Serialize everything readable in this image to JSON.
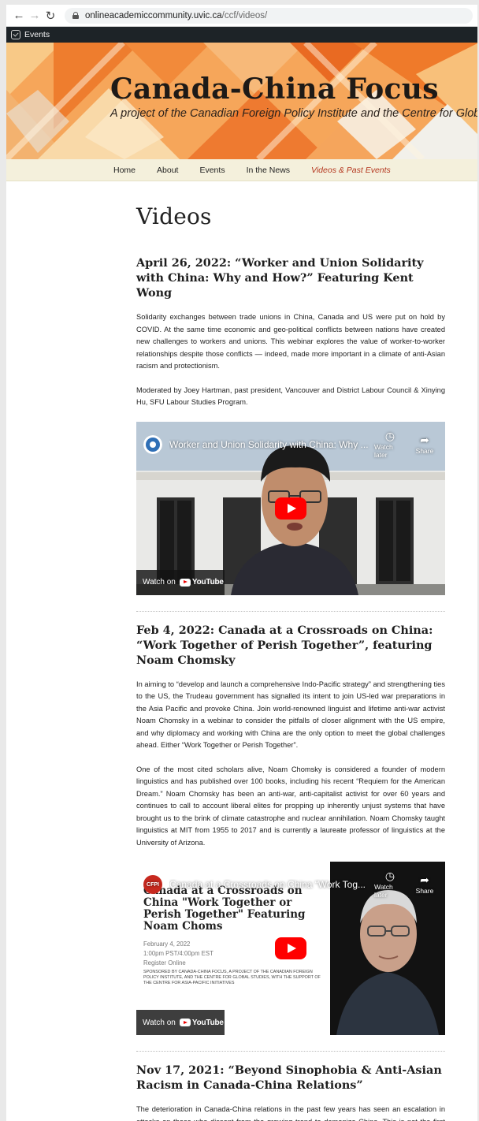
{
  "browser": {
    "url_domain": "onlineacademiccommunity.uvic.ca",
    "url_path": "/ccf/videos/"
  },
  "admin_bar": {
    "label": "Events"
  },
  "site": {
    "title": "Canada-China Focus",
    "description": "A project of the Canadian Foreign Policy Institute and the Centre for Global Studies"
  },
  "nav": {
    "items": [
      "Home",
      "About",
      "Events",
      "In the News",
      "Videos & Past Events"
    ],
    "current_index": 4
  },
  "page": {
    "title": "Videos"
  },
  "entries": [
    {
      "title": "April 26, 2022: “Worker and Union Solidarity with China: Why and How?” Featuring Kent Wong",
      "paragraphs": [
        "Solidarity exchanges between trade unions in China, Canada and US were put on hold by COVID. At the same time economic and geo-political conflicts between nations have created new challenges to workers and unions. This webinar explores the value of worker-to-worker relationships despite those conflicts — indeed, made more important in a climate of anti-Asian racism and protectionism.",
        "Moderated by Joey Hartman, past president, Vancouver and District Labour Council & Xinying Hu, SFU Labour Studies Program."
      ],
      "video": {
        "title": "Worker and Union Solidarity with China: Why ...",
        "watch_later": "Watch later",
        "share": "Share",
        "watch_on": "Watch on",
        "youtube": "YouTube"
      }
    },
    {
      "title": "Feb 4, 2022: Canada at a Crossroads on China: “Work Together of Perish Together”, featuring Noam Chomsky",
      "paragraphs": [
        "In aiming to “develop and launch a comprehensive Indo-Pacific strategy” and strengthening ties to the US, the Trudeau government has signalled its intent to join US-led war preparations in the Asia Pacific and provoke China. Join world-renowned linguist and lifetime anti-war activist Noam Chomsky in a webinar to consider the pitfalls of closer alignment with the US empire, and why diplomacy and working with China are the only option to meet the global challenges ahead. Either “Work Together or Perish Together”.",
        "One of the most cited scholars alive, Noam Chomsky is considered a founder of modern linguistics and has published over 100 books, including his recent “Requiem for the American Dream.” Noam Chomsky has been an anti-war, anti-capitalist activist for over 60 years and continues to call to account liberal elites for propping up inherently unjust systems that have brought us to the brink of climate catastrophe and nuclear annihilation. Noam Chomsky taught linguistics at MIT from 1955 to 2017 and is currently a laureate professor of linguistics at the University of Arizona."
      ],
      "video": {
        "channel_logo": "CFPI",
        "title": "Canada at a Crossroads on China “Work Tog...",
        "watch_later": "Watch later",
        "share": "Share",
        "watch_on": "Watch on",
        "youtube": "YouTube",
        "poster_heading": "Canada at a Crossroads on China \"Work Together or Perish Together\" Featuring Noam Choms",
        "poster_date": "February 4, 2022",
        "poster_time": "1:00pm PST/4:00pm EST",
        "poster_register": "Register Online",
        "poster_sponsor": "SPONSORED BY CANADA-CHINA FOCUS, A PROJECT OF THE CANADIAN FOREIGN POLICY INSTITUTE, AND THE CENTRE FOR GLOBAL STUDIES, WITH THE SUPPORT OF THE CENTRE FOR ASIA-PACIFIC INITIATIVES"
      }
    },
    {
      "title": "Nov 17, 2021: “Beyond Sinophobia & Anti-Asian Racism in Canada-China Relations”",
      "paragraphs": [
        "The deterioration in Canada-China relations in the past few years has seen an escalation in attacks on those who dissent from the growing trend to demonize China. This is not the first time this has happened. In the 1960s, Professor Paul Lin faced systemic harassment when he advocated for the establishment of diplomatic relations between China and Canada."
      ]
    }
  ],
  "colors": {
    "nav_current": "#b4371f",
    "nav_bg": "#f4f0dc",
    "admin_bar": "#1d2327"
  },
  "icons": [
    "back-arrow-icon",
    "forward-arrow-icon",
    "reload-icon",
    "lock-icon",
    "wordpress-icon",
    "clock-icon",
    "share-icon",
    "play-icon",
    "youtube-icon"
  ]
}
